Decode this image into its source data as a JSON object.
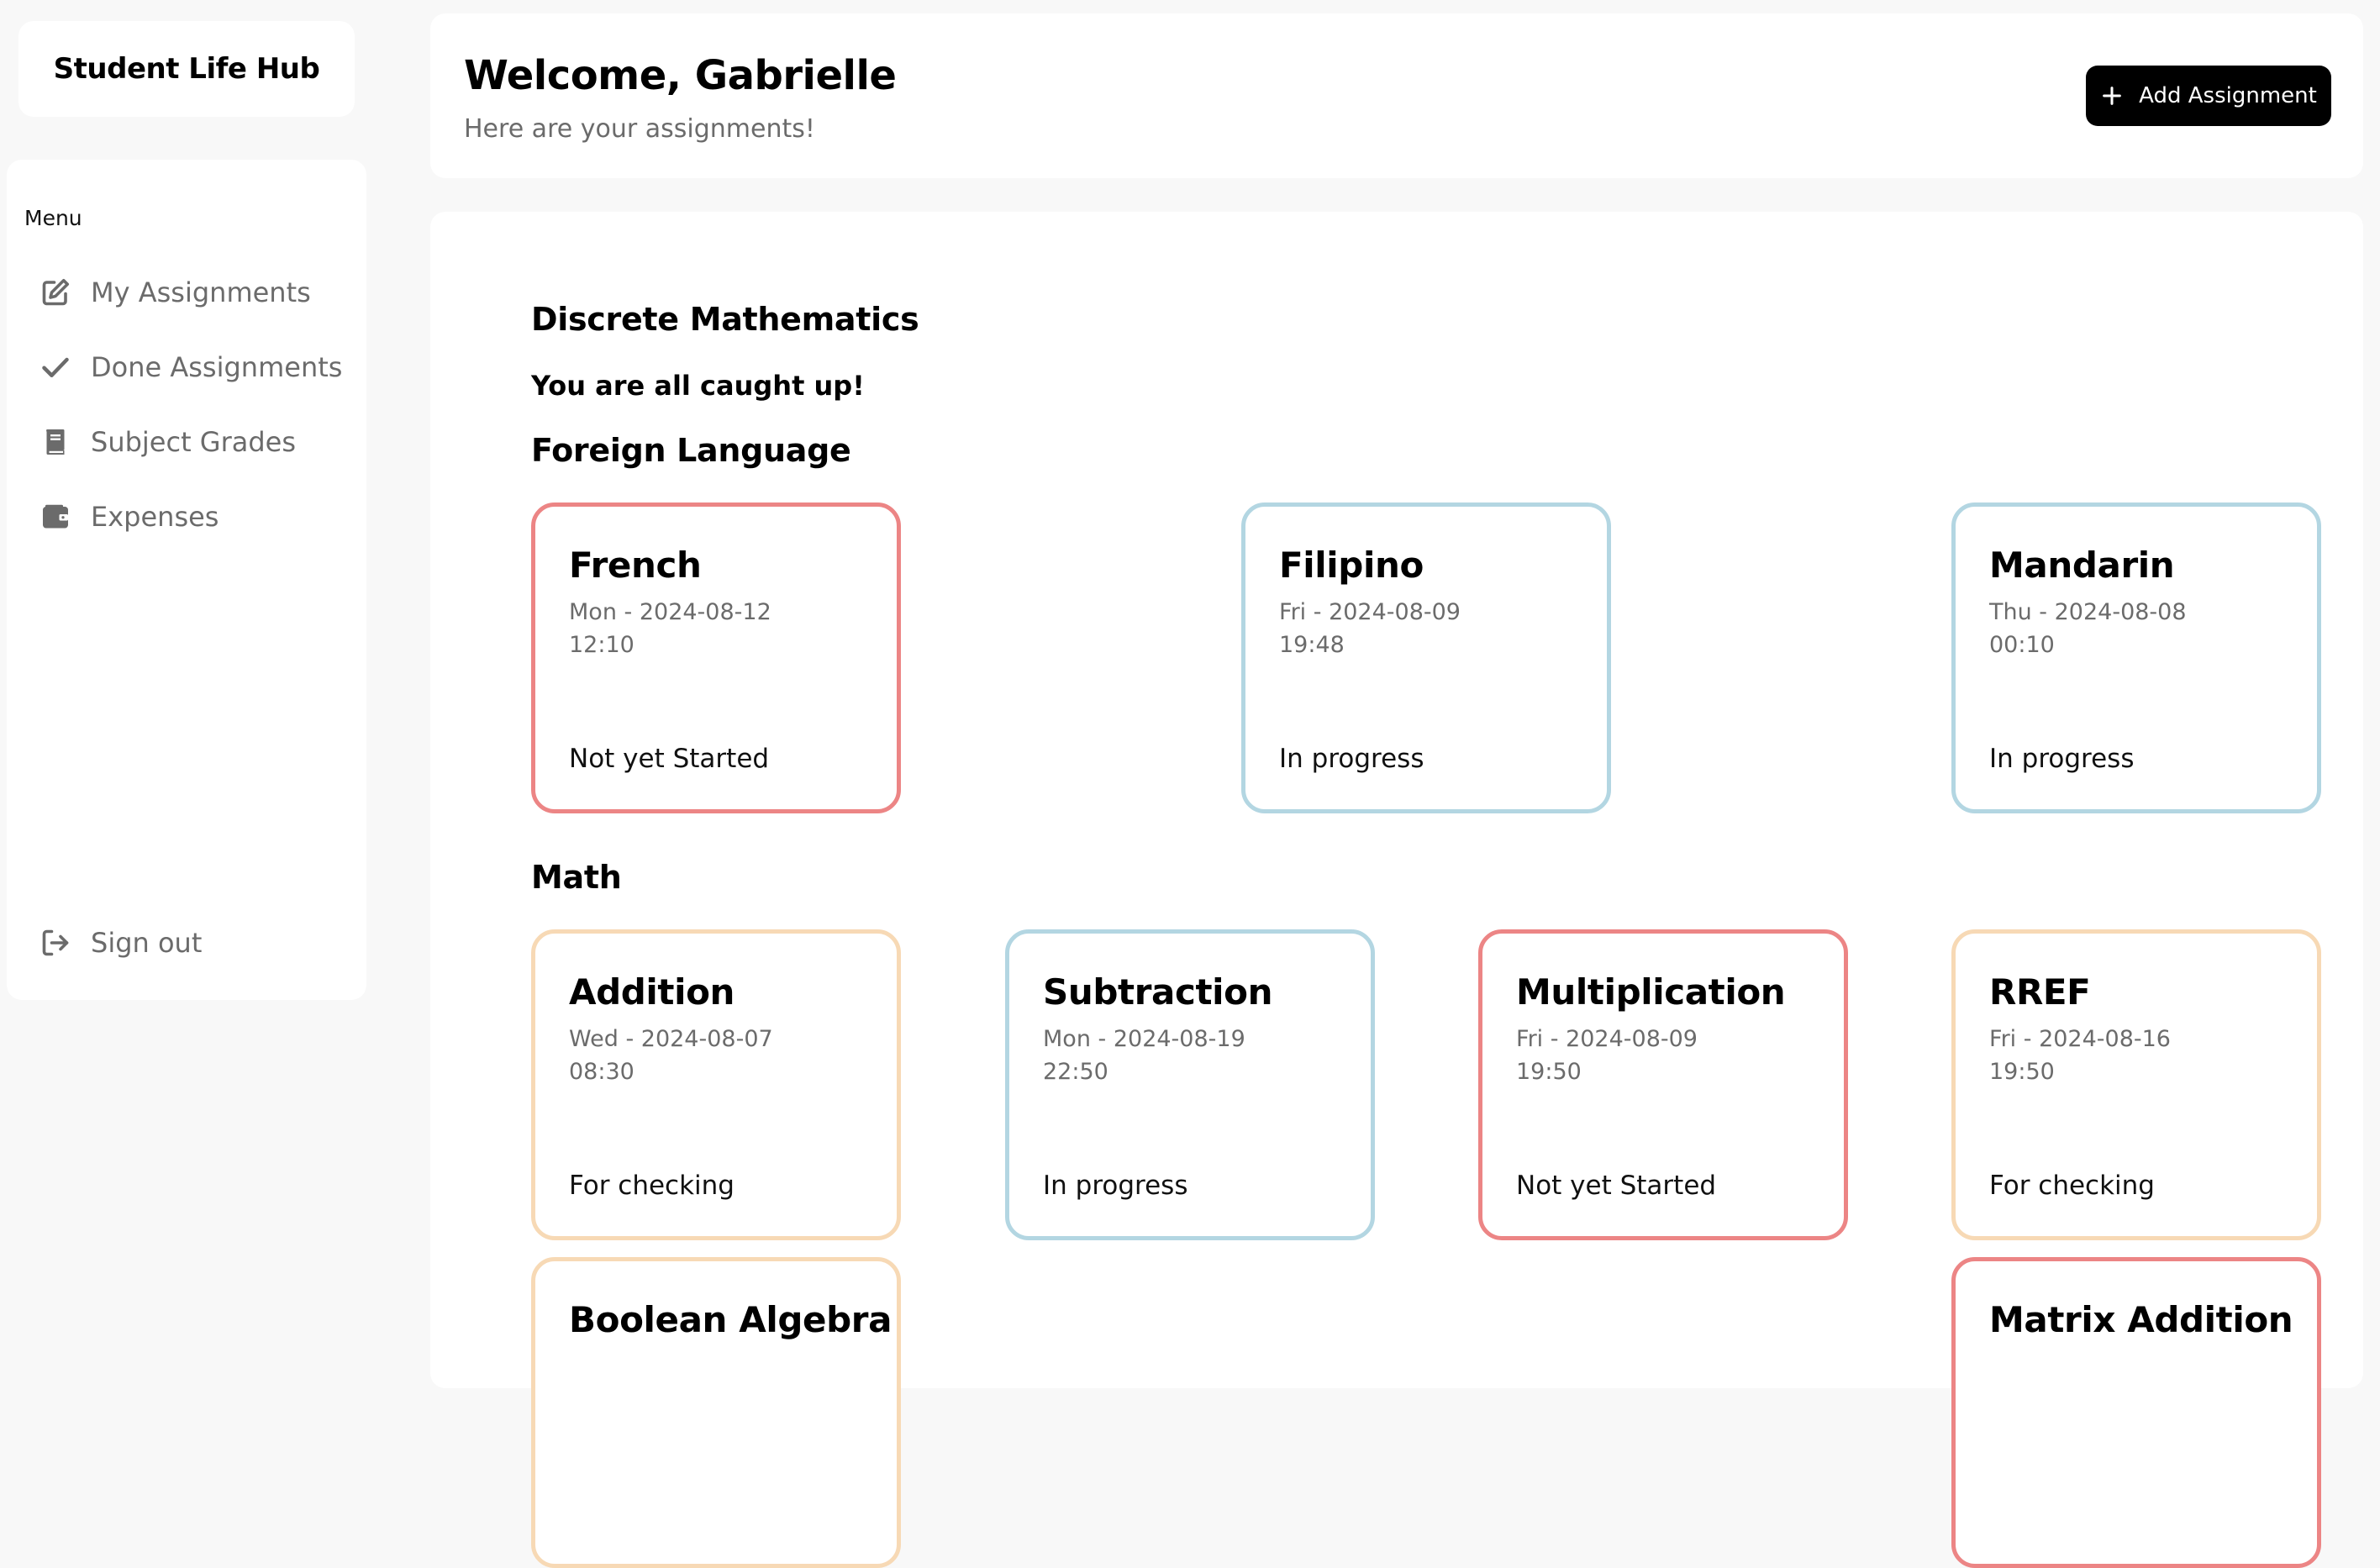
{
  "app": {
    "title": "Student Life Hub"
  },
  "sidebar": {
    "menu_label": "Menu",
    "items": [
      {
        "label": "My Assignments",
        "icon": "edit-icon"
      },
      {
        "label": "Done Assignments",
        "icon": "check-icon"
      },
      {
        "label": "Subject Grades",
        "icon": "book-icon"
      },
      {
        "label": "Expenses",
        "icon": "wallet-icon"
      }
    ],
    "signout": {
      "label": "Sign out",
      "icon": "sign-out-icon"
    }
  },
  "header": {
    "welcome": "Welcome, Gabrielle",
    "subtitle": "Here are your assignments!",
    "add_button": "Add Assignment"
  },
  "colors": {
    "not_started": "#ec8585",
    "in_progress": "#b3d6e2",
    "for_checking": "#f7d9b5"
  },
  "subjects": [
    {
      "name": "Discrete Mathematics",
      "empty_message": "You are all caught up!",
      "assignments": []
    },
    {
      "name": "Foreign Language",
      "assignments": [
        {
          "title": "French",
          "date": "Mon - 2024-08-12",
          "time": "12:10",
          "status": "Not yet Started"
        },
        {
          "title": "Filipino",
          "date": "Fri - 2024-08-09",
          "time": "19:48",
          "status": "In progress"
        },
        {
          "title": "Mandarin",
          "date": "Thu - 2024-08-08",
          "time": "00:10",
          "status": "In progress"
        }
      ]
    },
    {
      "name": "Math",
      "assignments": [
        {
          "title": "Addition",
          "date": "Wed - 2024-08-07",
          "time": "08:30",
          "status": "For checking"
        },
        {
          "title": "Subtraction",
          "date": "Mon - 2024-08-19",
          "time": "22:50",
          "status": "In progress"
        },
        {
          "title": "Multiplication",
          "date": "Fri - 2024-08-09",
          "time": "19:50",
          "status": "Not yet Started"
        },
        {
          "title": "RREF",
          "date": "Fri - 2024-08-16",
          "time": "19:50",
          "status": "For checking"
        },
        {
          "title": "Boolean Algebra"
        },
        {
          "title": "Matrix Addition"
        }
      ]
    }
  ]
}
